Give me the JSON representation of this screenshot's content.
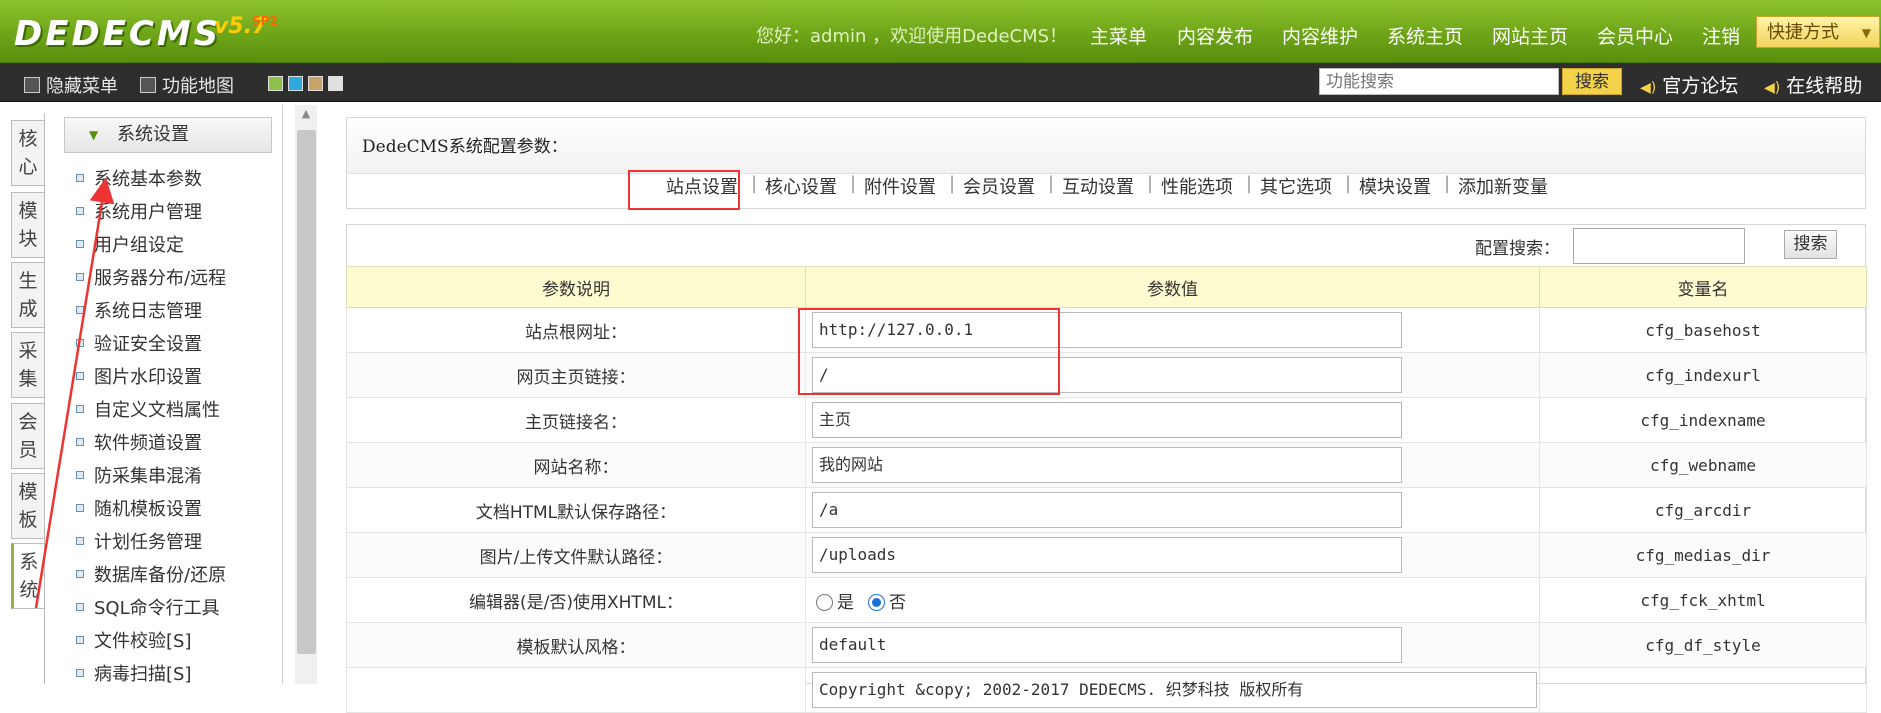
{
  "header": {
    "logo": "DEDECMS",
    "version": "v5.7",
    "version_sp": "SP2",
    "welcome": "您好：admin ，欢迎使用DedeCMS！",
    "nav": [
      "主菜单",
      "内容发布",
      "内容维护",
      "系统主页",
      "网站主页",
      "会员中心",
      "注销"
    ],
    "shortcut": "快捷方式"
  },
  "toolbar": {
    "hide_menu": "隐藏菜单",
    "func_map": "功能地图",
    "search_placeholder": "功能搜索",
    "search_btn": "搜索",
    "forum": "官方论坛",
    "help": "在线帮助",
    "swatch_colors": [
      "#8bc34a",
      "#2fa8e0",
      "#c9a46a",
      "#e0e0e0"
    ]
  },
  "left_tabs": [
    "核心",
    "模块",
    "生成",
    "采集",
    "会员",
    "模板",
    "系统"
  ],
  "menu": {
    "heading": "系统设置",
    "items": [
      "系统基本参数",
      "系统用户管理",
      "用户组设定",
      "服务器分布/远程",
      "系统日志管理",
      "验证安全设置",
      "图片水印设置",
      "自定义文档属性",
      "软件频道设置",
      "防采集串混淆",
      "随机模板设置",
      "计划任务管理",
      "数据库备份/还原",
      "SQL命令行工具",
      "文件校验[S]",
      "病毒扫描[S]"
    ]
  },
  "main": {
    "title": "DedeCMS系统配置参数：",
    "tabs": [
      "站点设置",
      "核心设置",
      "附件设置",
      "会员设置",
      "互动设置",
      "性能选项",
      "其它选项",
      "模块设置",
      "添加新变量"
    ],
    "config_search_label": "配置搜索：",
    "config_search_btn": "搜索",
    "columns": [
      "参数说明",
      "参数值",
      "变量名"
    ],
    "rows": [
      {
        "label": "站点根网址：",
        "value": "http://127.0.0.1",
        "var": "cfg_basehost"
      },
      {
        "label": "网页主页链接：",
        "value": "/",
        "var": "cfg_indexurl"
      },
      {
        "label": "主页链接名：",
        "value": "主页",
        "var": "cfg_indexname"
      },
      {
        "label": "网站名称：",
        "value": "我的网站",
        "var": "cfg_webname"
      },
      {
        "label": "文档HTML默认保存路径：",
        "value": "/a",
        "var": "cfg_arcdir"
      },
      {
        "label": "图片/上传文件默认路径：",
        "value": "/uploads",
        "var": "cfg_medias_dir"
      },
      {
        "label": "编辑器(是/否)使用XHTML：",
        "radio_yes": "是",
        "radio_no": "否",
        "var": "cfg_fck_xhtml"
      },
      {
        "label": "模板默认风格：",
        "value": "default",
        "var": "cfg_df_style"
      },
      {
        "label": "",
        "value": "Copyright &copy; 2002-2017 DEDECMS. 织梦科技 版权所有",
        "var": ""
      }
    ]
  }
}
